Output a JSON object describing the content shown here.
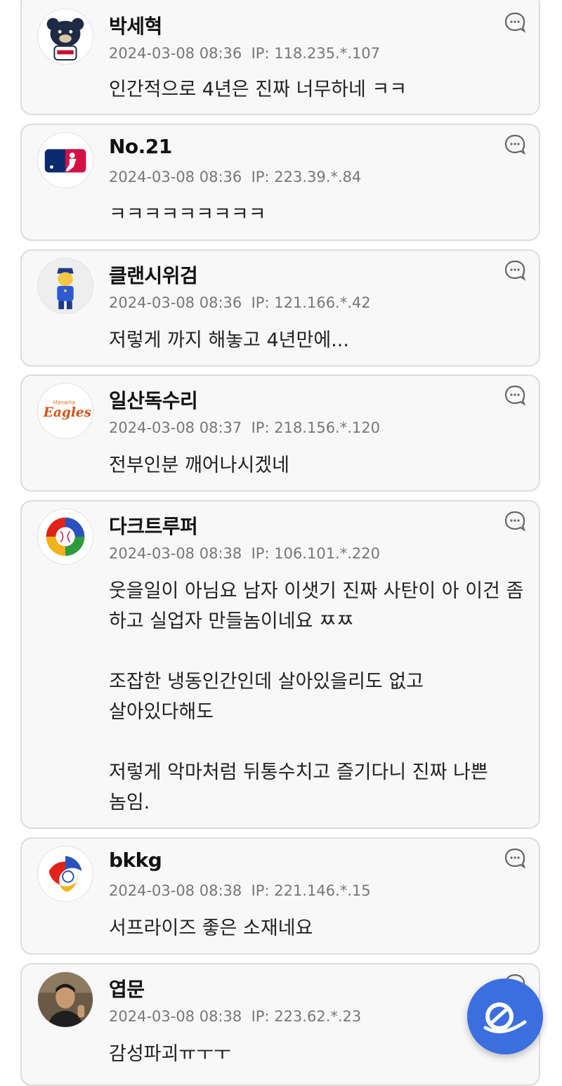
{
  "comments": [
    {
      "nick": "박세혁",
      "date": "2024-03-08 08:36",
      "ip": "IP: 118.235.*.107",
      "text": "인간적으로 4년은 진짜 너무하네 ㅋㅋ",
      "avatar": "bears-mascot"
    },
    {
      "nick": "No.21",
      "date": "2024-03-08 08:36",
      "ip": "IP: 223.39.*.84",
      "text": "ㅋㅋㅋㅋㅋㅋㅋㅋㅋ",
      "avatar": "mlb-logo"
    },
    {
      "nick": "클랜시위검",
      "date": "2024-03-08 08:36",
      "ip": "IP: 121.166.*.42",
      "text": "저렇게 까지 해놓고 4년만에...",
      "avatar": "police-cartoon"
    },
    {
      "nick": "일산독수리",
      "date": "2024-03-08 08:37",
      "ip": "IP: 218.156.*.120",
      "text": "전부인분 깨어나시겠네",
      "avatar": "eagles-logo",
      "avatar_text": "Eagles",
      "avatar_subtext": "Hanwha"
    },
    {
      "nick": "다크트루퍼",
      "date": "2024-03-08 08:38",
      "ip": "IP: 106.101.*.220",
      "text": "웃을일이 아님요 남자 이샛기 진짜 사탄이 아 이건 좀 하고 실업자 만들놈이네요 ㅉㅉ\n\n조잡한 냉동인간인데 살아있을리도 없고 살아있다해도\n\n저렇게 악마처럼 뒤통수치고 즐기다니 진짜 나쁜 놈임.",
      "avatar": "wbc-logo"
    },
    {
      "nick": "bkkg",
      "date": "2024-03-08 08:38",
      "ip": "IP: 221.146.*.15",
      "text": "서프라이즈 좋은 소재네요",
      "avatar": "kbo-logo"
    },
    {
      "nick": "엽문",
      "date": "2024-03-08 08:38",
      "ip": "IP: 223.62.*.23",
      "text": "감성파괴ㅠㅜㅜ",
      "avatar": "person-photo"
    }
  ],
  "colors": {
    "card_bg": "#f8f8f8",
    "card_border": "#dcdcdc",
    "fab": "#3b6fe0",
    "meta": "#777777"
  },
  "icons": {
    "reply": "speech-bubble-icon",
    "fab": "write-logo-icon"
  }
}
